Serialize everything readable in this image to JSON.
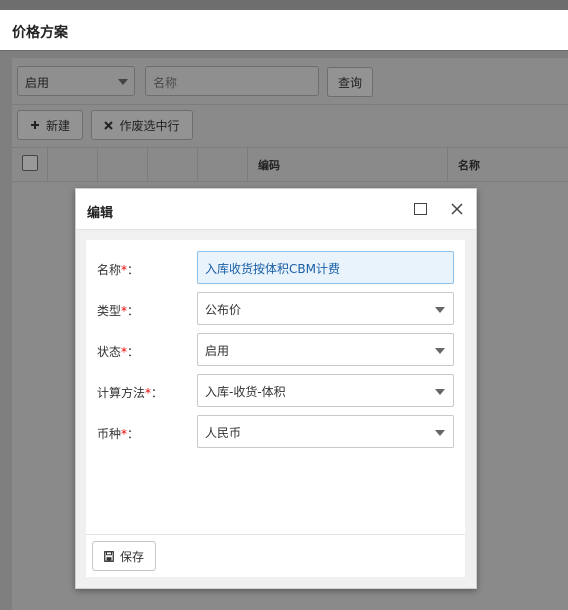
{
  "page": {
    "title": "价格方案"
  },
  "filters": {
    "status_value": "启用",
    "name_placeholder": "名称",
    "query_label": "查询"
  },
  "toolbar": {
    "new_label": "新建",
    "void_label": "作废选中行",
    "new_icon": "plus-icon",
    "void_icon": "cross-icon"
  },
  "table": {
    "columns": [
      "",
      "",
      "",
      "",
      "",
      "编码",
      "名称"
    ]
  },
  "dialog": {
    "title": "编辑",
    "fields": [
      {
        "label": "名称",
        "required_mark": "*",
        "colon": "：",
        "value": "入库收货按体积CBM计费",
        "type": "text"
      },
      {
        "label": "类型",
        "required_mark": "*",
        "colon": "：",
        "value": "公布价",
        "type": "select"
      },
      {
        "label": "状态",
        "required_mark": "*",
        "colon": "：",
        "value": "启用",
        "type": "select"
      },
      {
        "label": "计算方法",
        "required_mark": "*",
        "colon": "：",
        "value": "入库-收货-体积",
        "type": "select"
      },
      {
        "label": "币种",
        "required_mark": "*",
        "colon": "：",
        "value": "人民币",
        "type": "select"
      }
    ],
    "save_label": "保存"
  },
  "colors": {
    "overlay": "#7f7f7f",
    "required": "#e60000",
    "focused_field_bg": "#e8f3fb",
    "focused_field_text": "#1a5fa6"
  }
}
